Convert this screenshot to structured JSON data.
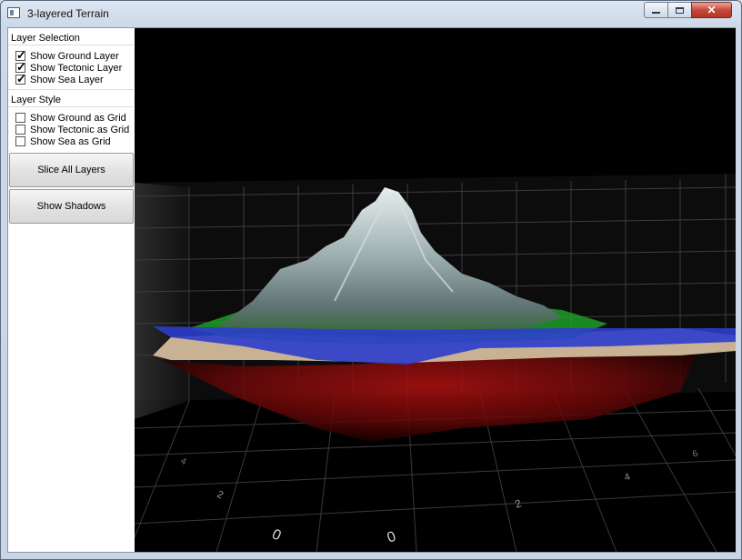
{
  "window": {
    "title": "3-layered Terrain"
  },
  "layer_selection": {
    "title": "Layer Selection",
    "items": [
      {
        "label": "Show Ground Layer",
        "checked": true
      },
      {
        "label": "Show Tectonic Layer",
        "checked": true
      },
      {
        "label": "Show Sea Layer",
        "checked": true
      }
    ]
  },
  "layer_style": {
    "title": "Layer Style",
    "items": [
      {
        "label": "Show Ground as Grid",
        "checked": false
      },
      {
        "label": "Show Tectonic as Grid",
        "checked": false
      },
      {
        "label": "Show Sea as Grid",
        "checked": false
      }
    ]
  },
  "buttons": {
    "slice": "Slice All Layers",
    "shadows": "Show Shadows"
  },
  "axis_labels": [
    "0",
    "0",
    "2",
    "2",
    "4",
    "4",
    "6"
  ],
  "colors": {
    "ground": "#c9b294",
    "mountain": "#9fb0b2",
    "vegetation": "#1f9d26",
    "sea": "#2c3dcc",
    "tectonic": "#8a0b0b"
  }
}
